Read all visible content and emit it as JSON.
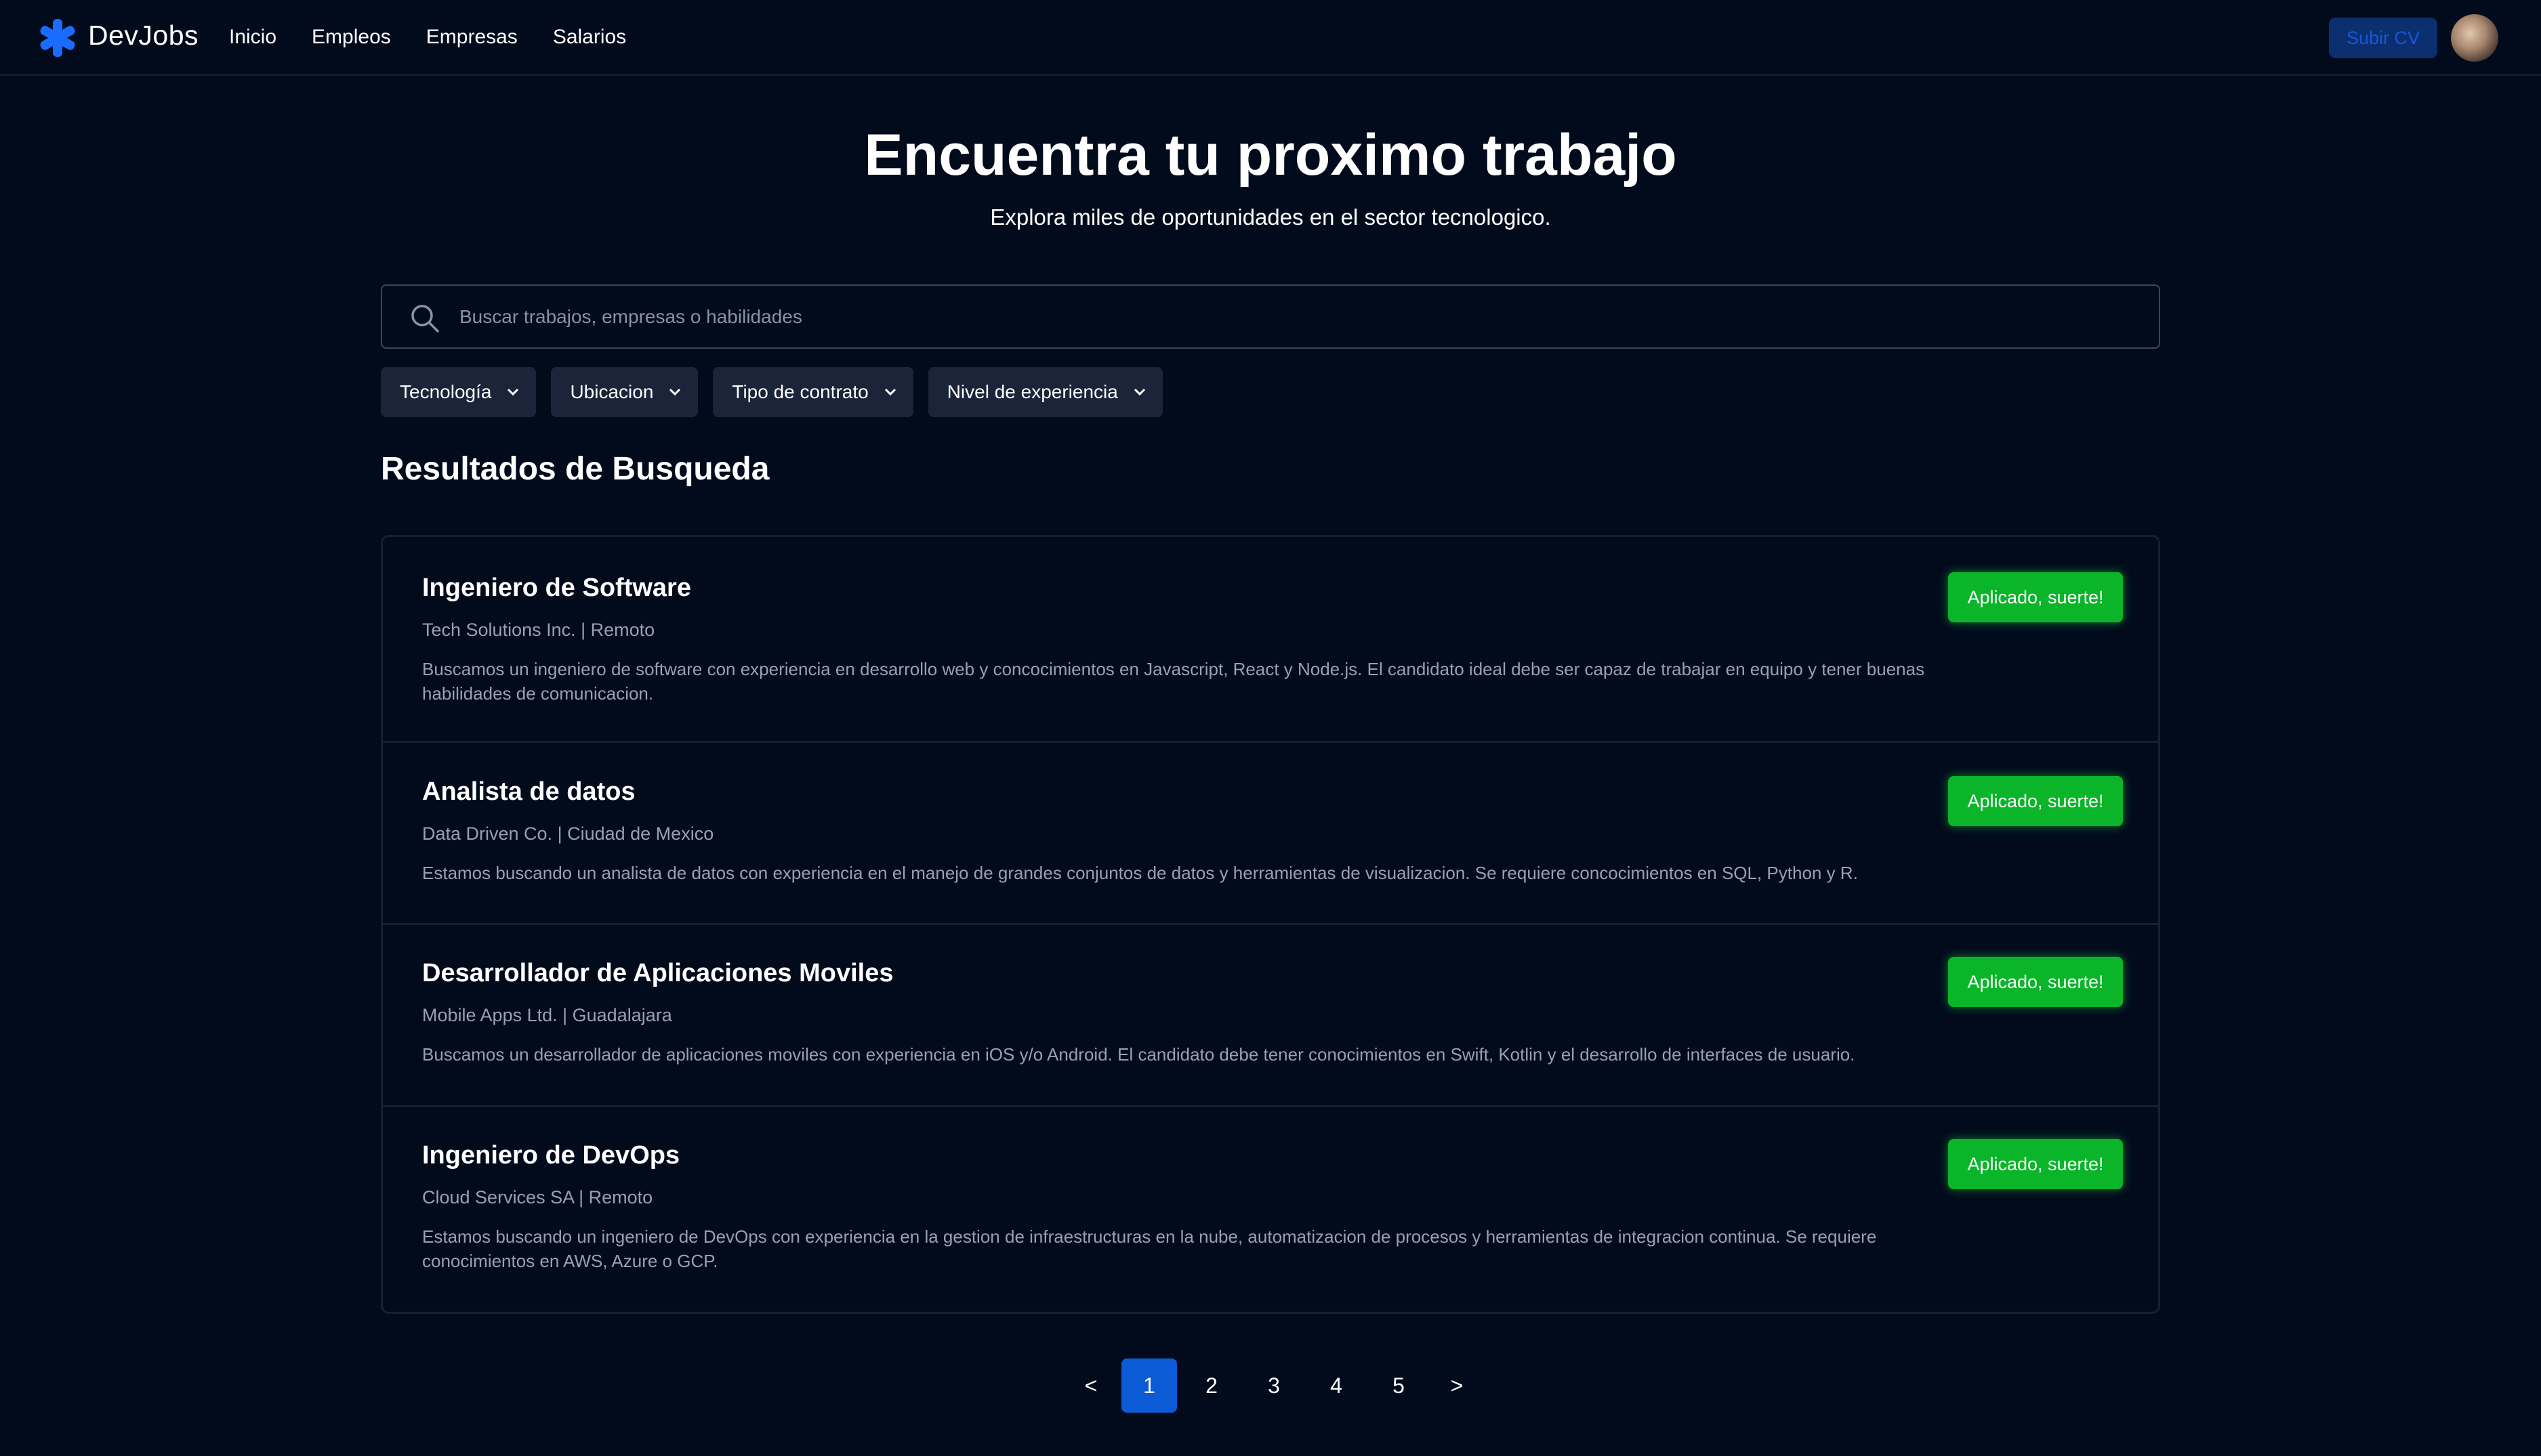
{
  "header": {
    "brand": "DevJobs",
    "nav": [
      "Inicio",
      "Empleos",
      "Empresas",
      "Salarios"
    ],
    "upload_label": "Subir CV"
  },
  "hero": {
    "title": "Encuentra tu proximo trabajo",
    "subtitle": "Explora miles de oportunidades en el sector tecnologico."
  },
  "search": {
    "placeholder": "Buscar trabajos, empresas o habilidades",
    "value": ""
  },
  "filters": [
    "Tecnología",
    "Ubicacion",
    "Tipo de contrato",
    "Nivel de experiencia"
  ],
  "results": {
    "title": "Resultados de Busqueda",
    "jobs": [
      {
        "title": "Ingeniero de Software",
        "meta": "Tech Solutions Inc. | Remoto",
        "description": "Buscamos un ingeniero de software con experiencia en desarrollo web y concocimientos en Javascript, React y Node.js. El candidato ideal debe ser capaz de trabajar en equipo y tener buenas habilidades de comunicacion.",
        "button": "Aplicado, suerte!"
      },
      {
        "title": "Analista de datos",
        "meta": "Data Driven Co. | Ciudad de Mexico",
        "description": "Estamos buscando un analista de datos con experiencia en el manejo de grandes conjuntos de datos y herramientas de visualizacion. Se requiere concocimientos en SQL, Python y R.",
        "button": "Aplicado, suerte!"
      },
      {
        "title": "Desarrollador de Aplicaciones Moviles",
        "meta": "Mobile Apps Ltd. | Guadalajara",
        "description": "Buscamos un desarrollador de aplicaciones moviles con experiencia en iOS y/o Android. El candidato debe tener conocimientos en Swift, Kotlin y el desarrollo de interfaces de usuario.",
        "button": "Aplicado, suerte!"
      },
      {
        "title": "Ingeniero de DevOps",
        "meta": "Cloud Services SA | Remoto",
        "description": "Estamos buscando un ingeniero de DevOps con experiencia en la gestion de infraestructuras en la nube, automatizacion de procesos y herramientas de integracion continua. Se requiere conocimientos en AWS, Azure o GCP.",
        "button": "Aplicado, suerte!"
      }
    ]
  },
  "pagination": {
    "prev": "<",
    "pages": [
      "1",
      "2",
      "3",
      "4",
      "5"
    ],
    "next": ">",
    "current": "1"
  },
  "colors": {
    "background": "#020b1c",
    "accent": "#0c5bd6",
    "success": "#0bb52a",
    "logo": "#1a6bff"
  },
  "icons": [
    "asterisk-logo-icon",
    "search-icon",
    "chevron-down-icon"
  ]
}
